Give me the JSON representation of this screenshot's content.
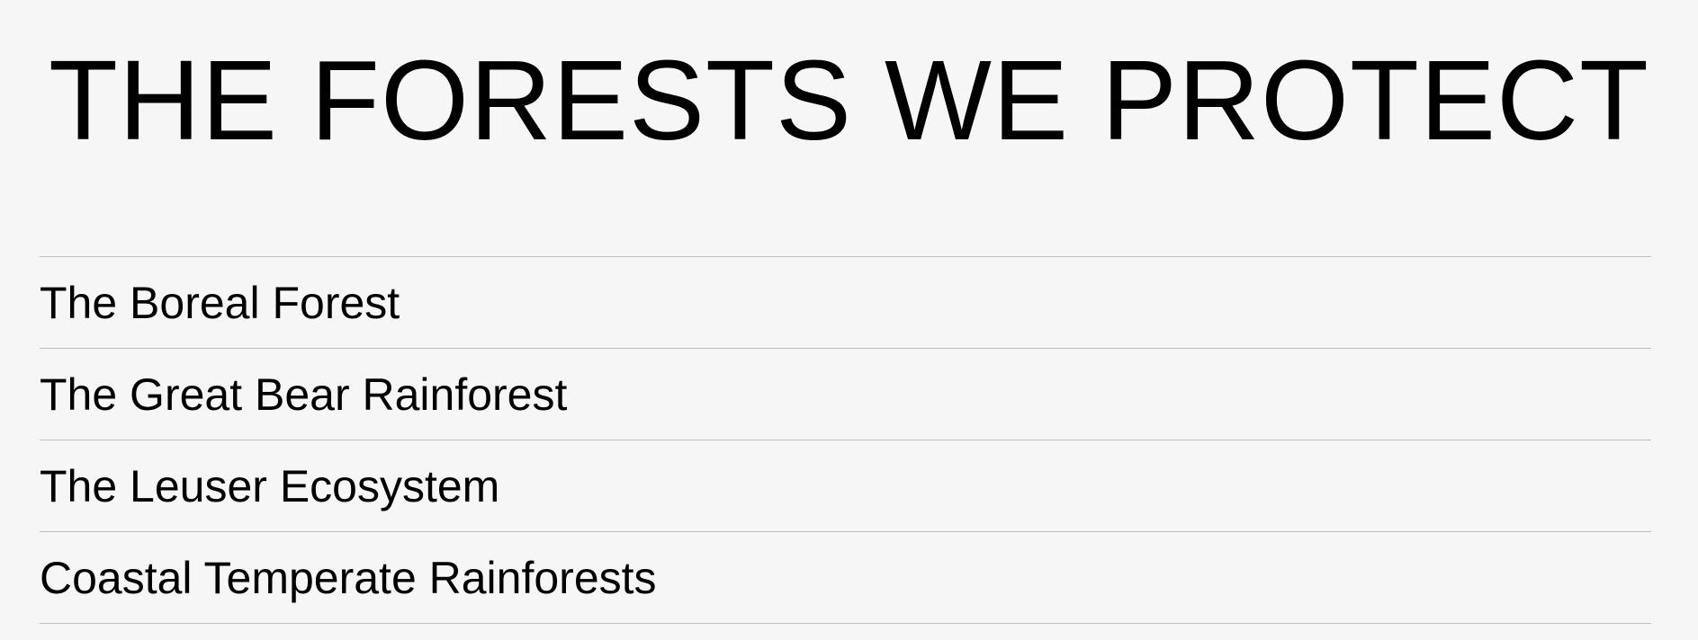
{
  "header": {
    "title": "THE FORESTS WE PROTECT"
  },
  "forests": {
    "items": [
      {
        "label": "The Boreal Forest"
      },
      {
        "label": "The Great Bear Rainforest"
      },
      {
        "label": "The Leuser Ecosystem"
      },
      {
        "label": "Coastal Temperate Rainforests"
      }
    ]
  },
  "colors": {
    "background": "#f6f6f6",
    "text": "#000000",
    "divider": "#bdbdbd"
  }
}
